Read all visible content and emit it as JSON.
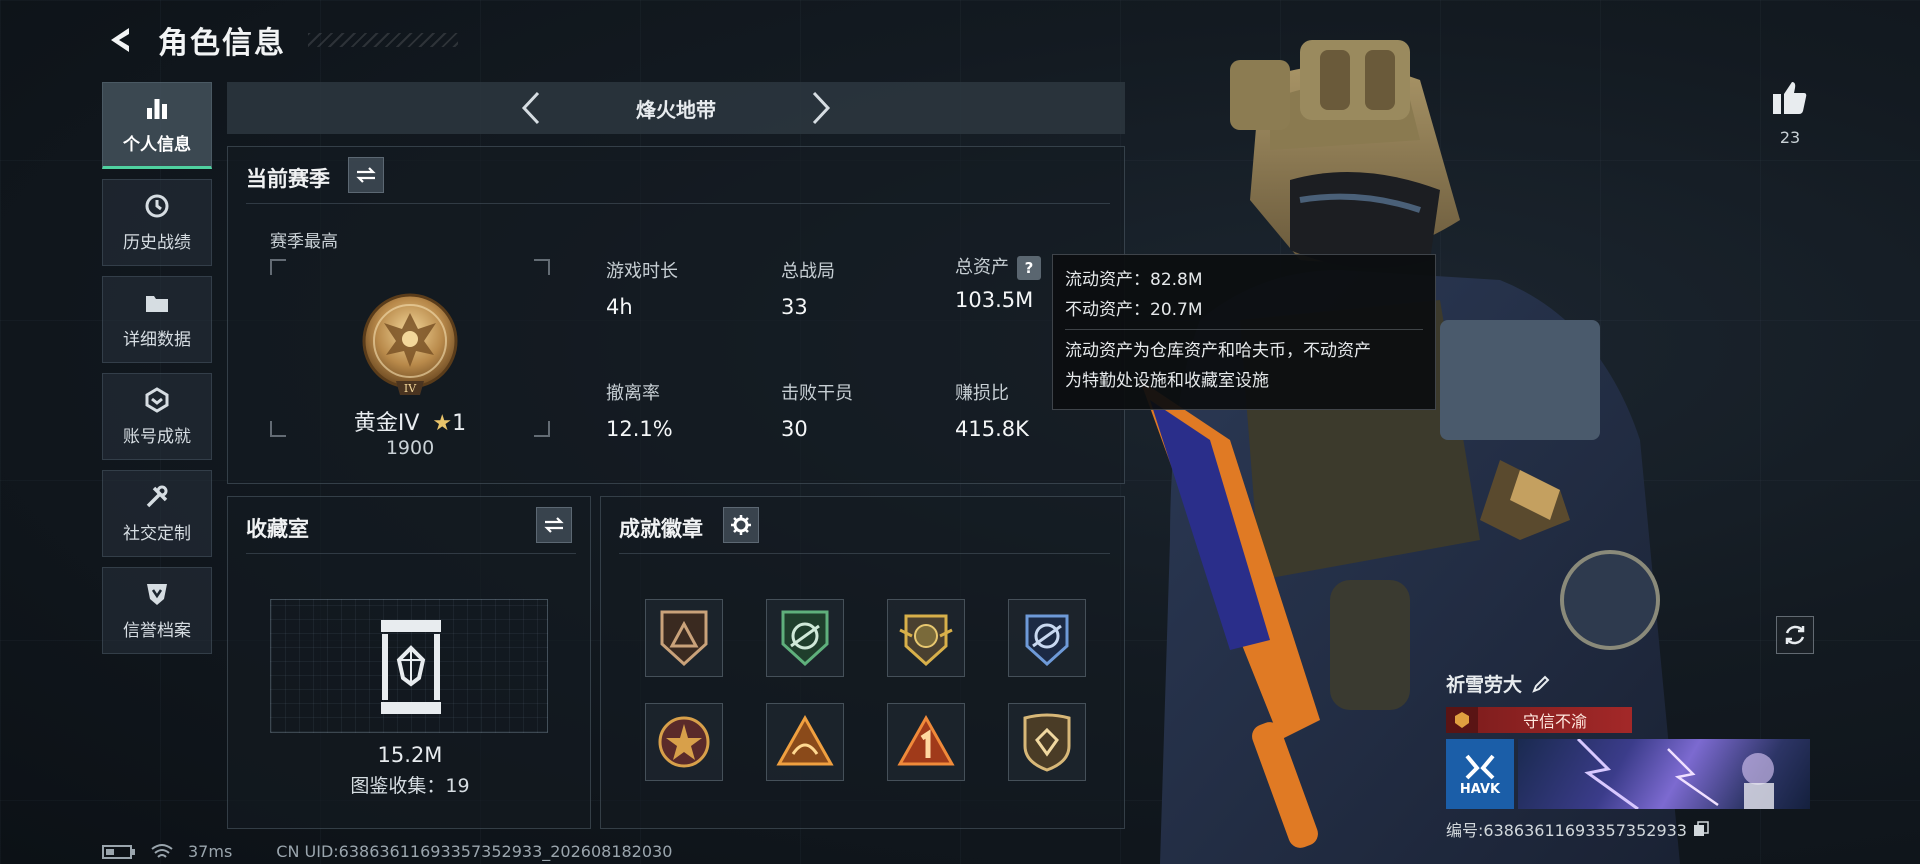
{
  "header": {
    "title": "角色信息"
  },
  "sidebar": {
    "items": [
      {
        "label": "个人信息",
        "icon": "bar-chart-icon",
        "active": true
      },
      {
        "label": "历史战绩",
        "icon": "history-icon"
      },
      {
        "label": "详细数据",
        "icon": "folder-icon"
      },
      {
        "label": "账号成就",
        "icon": "achievement-icon"
      },
      {
        "label": "社交定制",
        "icon": "wrench-icon"
      },
      {
        "label": "信誉档案",
        "icon": "shield-icon"
      }
    ]
  },
  "mode": {
    "name": "烽火地带"
  },
  "season": {
    "title": "当前赛季",
    "subtitle": "赛季最高",
    "rank": {
      "name": "黄金IV",
      "stars": "1",
      "score": "1900",
      "badge_numeral": "IV"
    },
    "stats": [
      {
        "label": "游戏时长",
        "value": "4h"
      },
      {
        "label": "总战局",
        "value": "33"
      },
      {
        "label": "总资产",
        "value": "103.5M"
      },
      {
        "label": "撤离率",
        "value": "12.1%"
      },
      {
        "label": "击败干员",
        "value": "30"
      },
      {
        "label": "赚损比",
        "value": "415.8K"
      }
    ],
    "help_symbol": "?"
  },
  "tooltip": {
    "line1": "流动资产：82.8M",
    "line2": "不动资产：20.7M",
    "desc1": "流动资产为仓库资产和哈夫币，不动资产",
    "desc2": "为特勤处设施和收藏室设施"
  },
  "collection": {
    "title": "收藏室",
    "value": "15.2M",
    "count": "图鉴收集：19"
  },
  "badges": {
    "title": "成就徽章",
    "items": [
      {
        "name": "triangle-shield-badge",
        "color": "#c9a27a"
      },
      {
        "name": "green-wing-badge",
        "color": "#3e8a5a"
      },
      {
        "name": "gold-crest-badge",
        "color": "#c9a24a"
      },
      {
        "name": "blue-wing-badge",
        "color": "#4a74b8"
      },
      {
        "name": "star-medal-badge",
        "color": "#b84a3a"
      },
      {
        "name": "orange-triangle-badge",
        "color": "#d68a3a"
      },
      {
        "name": "number-one-badge",
        "color": "#d66a2a"
      },
      {
        "name": "gem-shield-badge",
        "color": "#c9a86a"
      }
    ]
  },
  "status": {
    "ping": "37ms",
    "uid": "CN UID:63863611693357352933_202608182030"
  },
  "profile": {
    "likes": "23",
    "player_name": "祈雪劳大",
    "player_title": "守信不渝",
    "banner_logo": "HAVK",
    "player_id": "编号:63863611693357352933"
  },
  "colors": {
    "accent": "#4fd1a0",
    "title_red": "#a32828",
    "logo_blue": "#1b5ea8"
  }
}
